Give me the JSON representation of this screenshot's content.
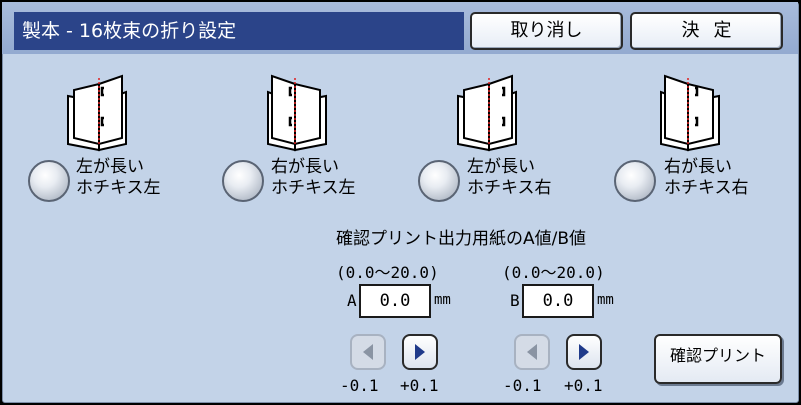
{
  "header": {
    "title": "製本 - 16枚束の折り設定",
    "cancel_label": "取り消し",
    "ok_label": "決定"
  },
  "options": [
    {
      "line1": "左が長い",
      "line2": "ホチキス左"
    },
    {
      "line1": "右が長い",
      "line2": "ホチキス左"
    },
    {
      "line1": "左が長い",
      "line2": "ホチキス右"
    },
    {
      "line1": "右が長い",
      "line2": "ホチキス右"
    }
  ],
  "paper": {
    "heading": "確認プリント出力用紙のA値/B値",
    "a": {
      "range": "(0.0～20.0)",
      "label": "A",
      "value": "0.0",
      "unit": "mm",
      "dec": "-0.1",
      "inc": "+0.1"
    },
    "b": {
      "range": "(0.0～20.0)",
      "label": "B",
      "value": "0.0",
      "unit": "mm",
      "dec": "-0.1",
      "inc": "+0.1"
    }
  },
  "confirm_print_label": "確認プリント"
}
